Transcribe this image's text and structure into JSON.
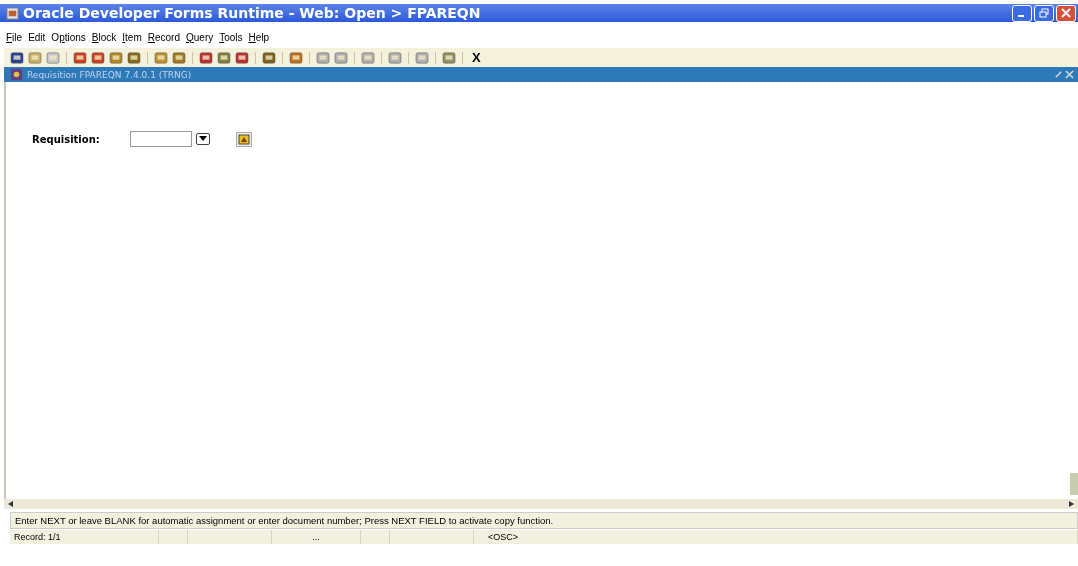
{
  "window": {
    "title": "Oracle Developer Forms Runtime - Web:  Open > FPAREQN"
  },
  "menu": [
    {
      "key": "F",
      "rest": "ile"
    },
    {
      "rest": "Edit"
    },
    {
      "pre": "O",
      "key": "p",
      "rest": "tions"
    },
    {
      "key": "B",
      "rest": "lock"
    },
    {
      "key": "I",
      "rest": "tem"
    },
    {
      "key": "R",
      "rest": "ecord"
    },
    {
      "key": "Q",
      "rest": "uery"
    },
    {
      "key": "T",
      "rest": "ools"
    },
    {
      "key": "H",
      "rest": "elp"
    }
  ],
  "toolbar": {
    "exit_label": "X"
  },
  "form": {
    "title": "Requisition  FPAREQN  7.4.0.1  (TRNG)",
    "field_label": "Requisition:"
  },
  "message": "Enter NEXT or leave BLANK for automatic assignment or enter document number; Press NEXT FIELD to activate copy function.",
  "status_bar": [
    "Record: 1/1",
    "...",
    "<OSC>"
  ]
}
